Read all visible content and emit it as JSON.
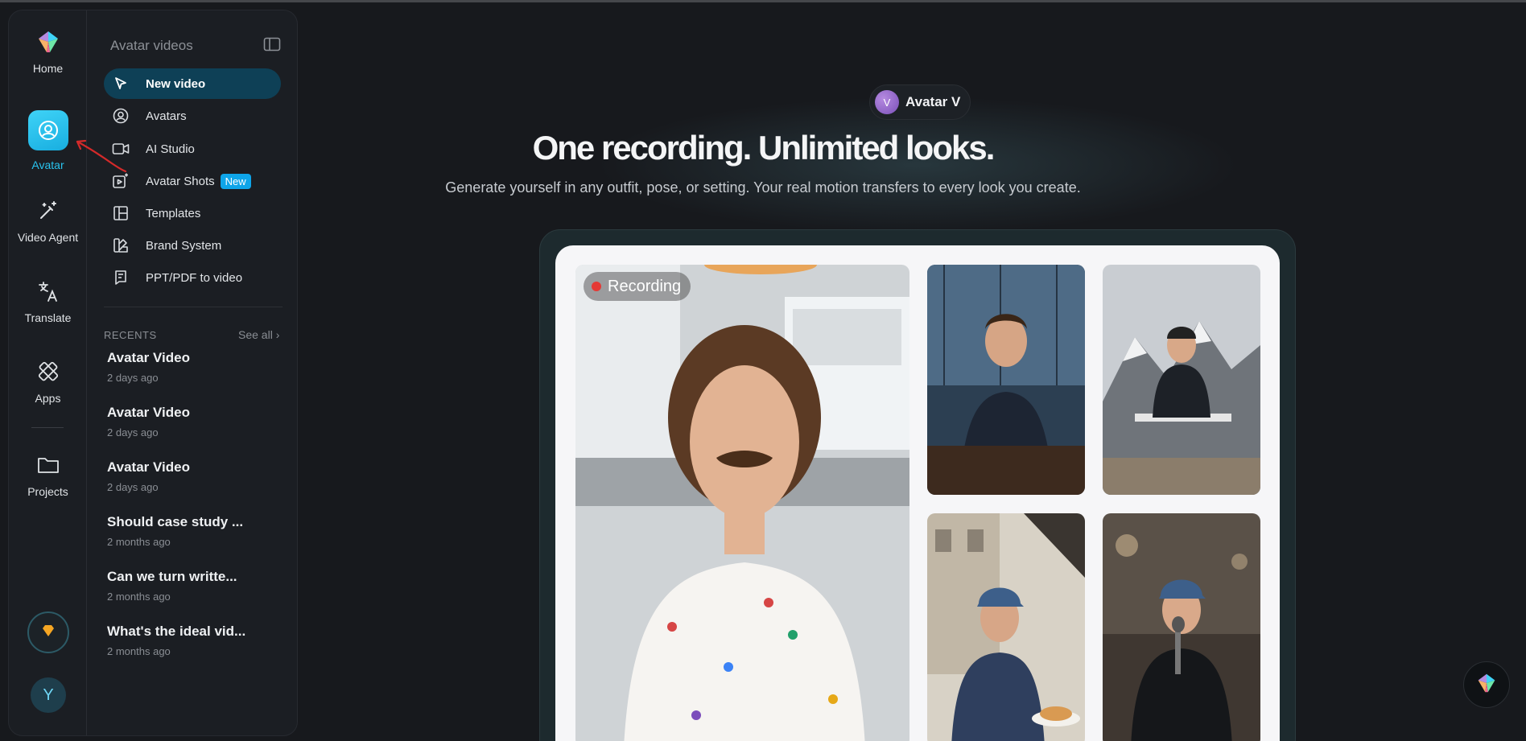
{
  "rail": {
    "items": [
      {
        "label": "Home",
        "icon": "logo-icon"
      },
      {
        "label": "Avatar",
        "icon": "avatar-icon",
        "active": true
      },
      {
        "label": "Video Agent",
        "icon": "magic-wand-icon"
      },
      {
        "label": "Translate",
        "icon": "translate-icon"
      },
      {
        "label": "Apps",
        "icon": "tools-icon"
      },
      {
        "label": "Projects",
        "icon": "folder-icon"
      }
    ],
    "premium_icon": "diamond-icon",
    "user_initial": "Y"
  },
  "sidebar": {
    "title": "Avatar videos",
    "nav": [
      {
        "label": "New video",
        "icon": "cursor-icon",
        "active": true
      },
      {
        "label": "Avatars",
        "icon": "user-circle-icon"
      },
      {
        "label": "AI Studio",
        "icon": "video-camera-icon"
      },
      {
        "label": "Avatar Shots",
        "icon": "image-sparkle-icon",
        "badge": "New"
      },
      {
        "label": "Templates",
        "icon": "layout-icon"
      },
      {
        "label": "Brand System",
        "icon": "palette-icon"
      },
      {
        "label": "PPT/PDF to video",
        "icon": "presentation-icon"
      }
    ],
    "recents_heading": "RECENTS",
    "see_all": "See all ›",
    "recents": [
      {
        "title": "Avatar Video",
        "date": "2 days ago"
      },
      {
        "title": "Avatar Video",
        "date": "2 days ago"
      },
      {
        "title": "Avatar Video",
        "date": "2 days ago"
      },
      {
        "title": "Should case study ...",
        "date": "2 months ago"
      },
      {
        "title": "Can we turn writte...",
        "date": "2 months ago"
      },
      {
        "title": "What's the ideal vid...",
        "date": "2 months ago"
      }
    ]
  },
  "hero": {
    "pill_initial": "V",
    "pill_label": "Avatar V",
    "headline": "One recording. Unlimited looks.",
    "subhead": "Generate yourself in any outfit, pose, or setting. Your real motion transfers to every look you create."
  },
  "preview": {
    "recording_label": "Recording"
  },
  "colors": {
    "accent": "#29c3ee",
    "active_nav_bg": "#0e4056",
    "badge": "#0ea5e9",
    "background": "#17191d"
  }
}
